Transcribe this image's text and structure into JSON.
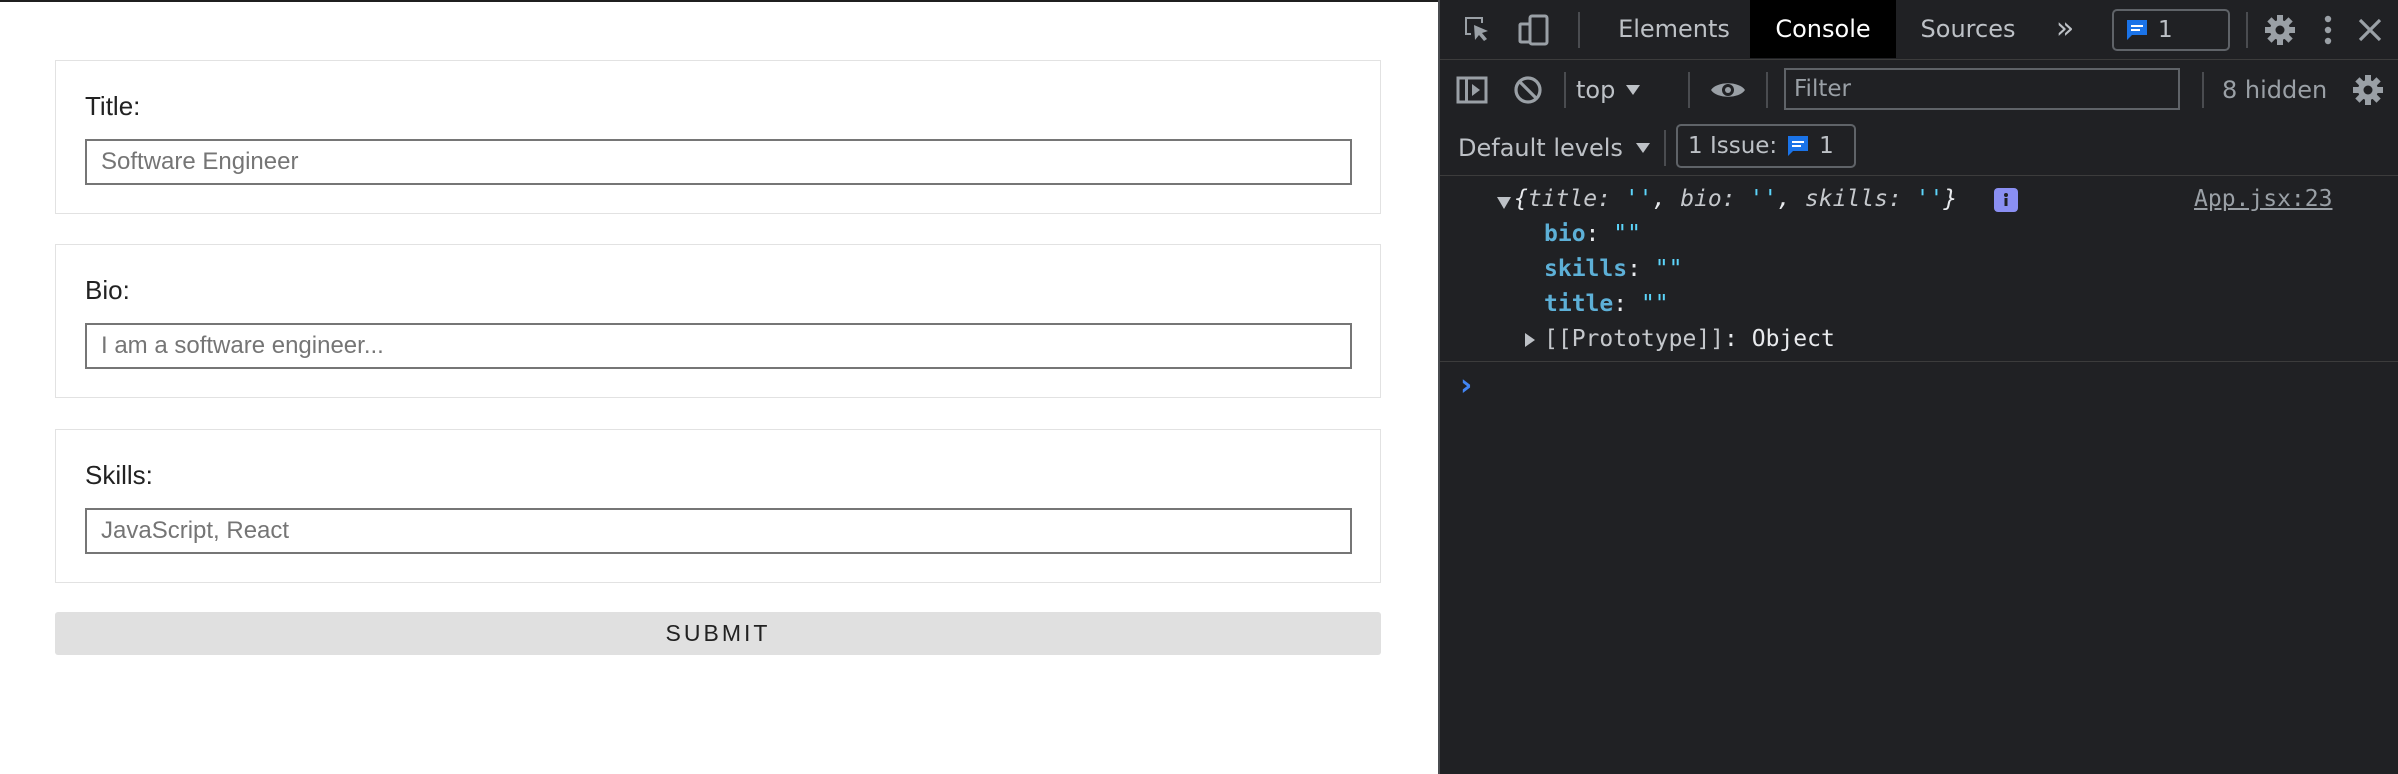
{
  "form": {
    "title_label": "Title:",
    "title_placeholder": "Software Engineer",
    "bio_label": "Bio:",
    "bio_placeholder": "I am a software engineer...",
    "skills_label": "Skills:",
    "skills_placeholder": "JavaScript, React",
    "submit_label": "SUBMIT"
  },
  "devtools": {
    "tabs": [
      "Elements",
      "Console",
      "Sources"
    ],
    "active_tab": "Console",
    "more_tabs": "»",
    "issues_badge_count": "1",
    "context": "top",
    "filter_placeholder": "Filter",
    "hidden_count": "8 hidden",
    "levels": "Default levels",
    "issues_button": "1 Issue:",
    "issues_button_count": "1",
    "log": {
      "summary_open": "{",
      "summary_k1": "title",
      "summary_k2": "bio",
      "summary_k3": "skills",
      "summary_empty": "''",
      "summary_close": "}",
      "source": "App.jsx:23",
      "props": [
        {
          "key": "bio",
          "value": "\"\""
        },
        {
          "key": "skills",
          "value": "\"\""
        },
        {
          "key": "title",
          "value": "\"\""
        }
      ],
      "prototype_key": "[[Prototype]]",
      "prototype_value": "Object"
    },
    "prompt_glyph": "›"
  },
  "colors": {
    "devtools_bg": "#202124",
    "accent_blue": "#1a73e8",
    "info_badge": "#8a8ff2"
  }
}
